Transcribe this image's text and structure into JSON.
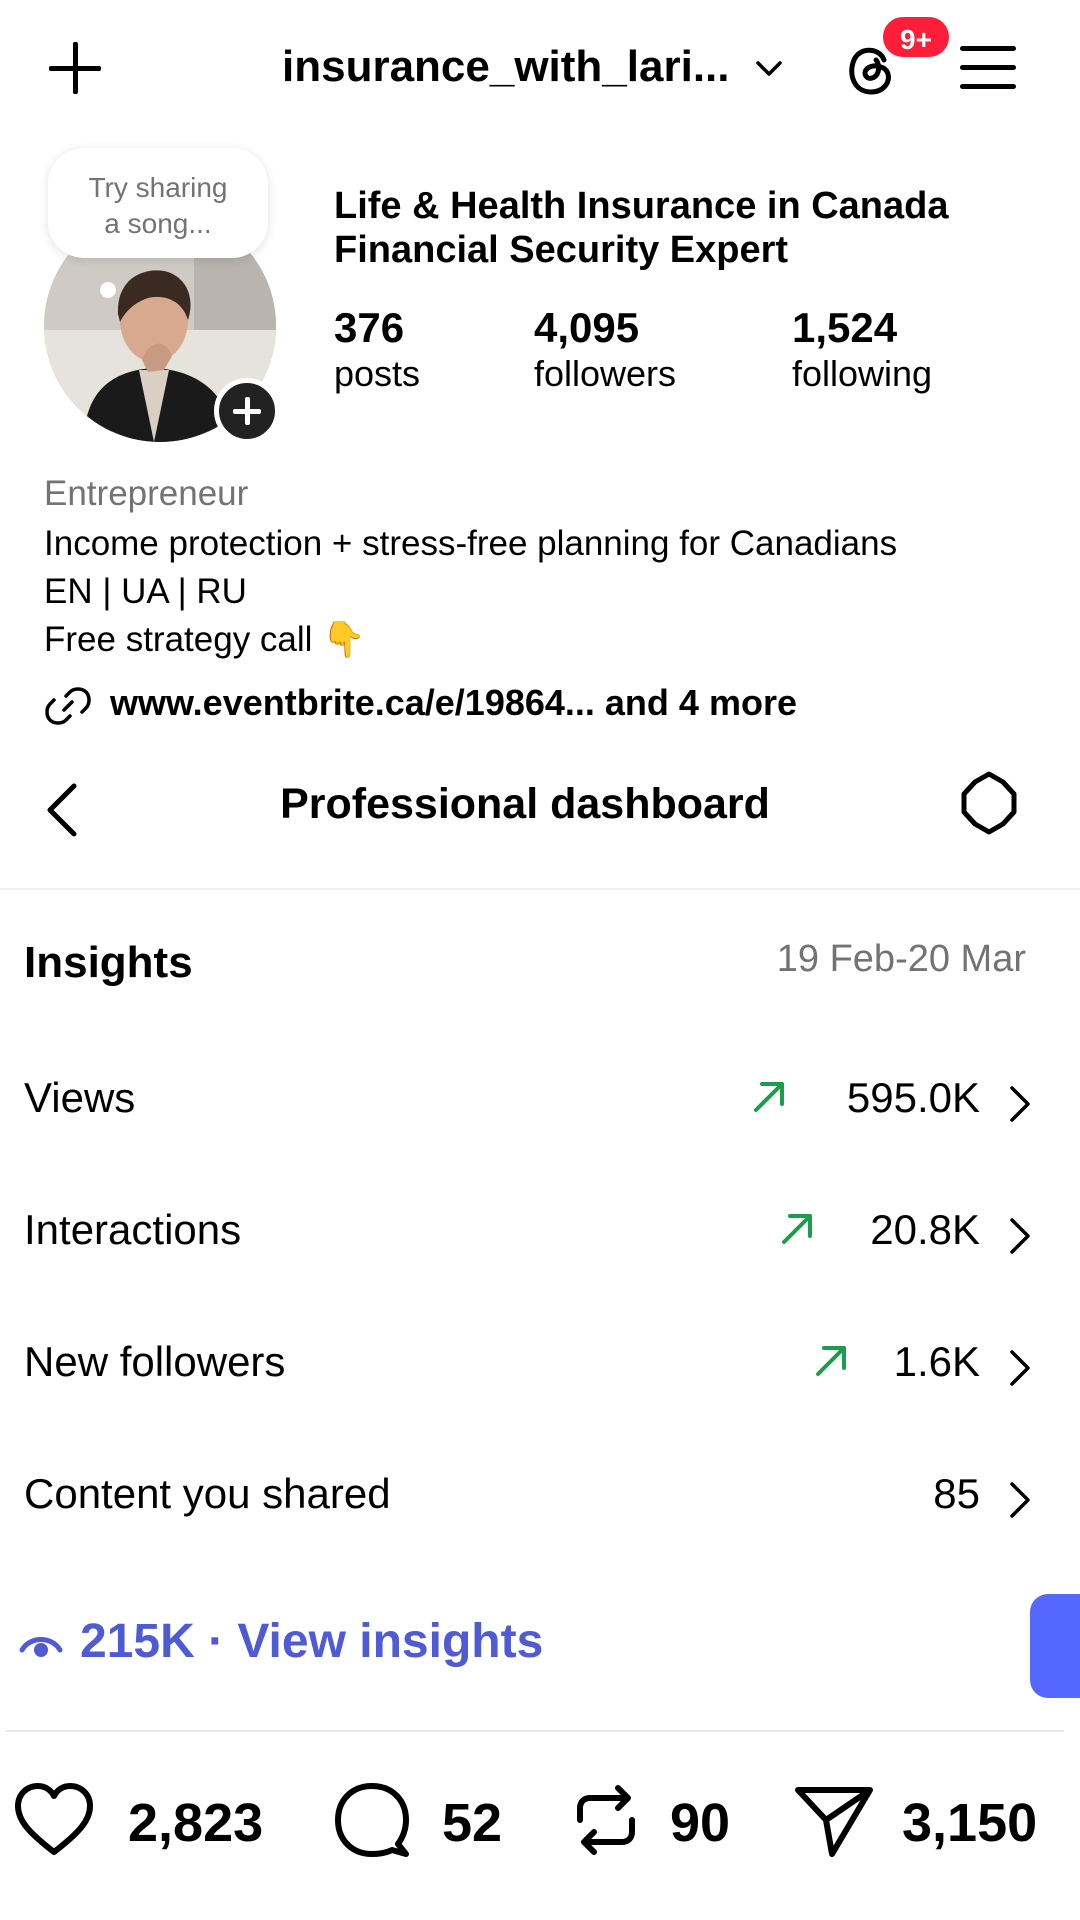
{
  "header": {
    "username": "insurance_with_lari...",
    "notification_count": "9+"
  },
  "profile": {
    "note_prompt": "Try sharing a song...",
    "name_line1": "Life & Health Insurance in Canada",
    "name_line2": "Financial Security Expert",
    "stats": [
      {
        "value": "376",
        "label": "posts"
      },
      {
        "value": "4,095",
        "label": "followers"
      },
      {
        "value": "1,524",
        "label": "following"
      }
    ],
    "category": "Entrepreneur",
    "bio_lines": [
      "Income protection + stress-free planning for Canadians",
      "EN | UA | RU",
      "Free strategy call 👇"
    ],
    "link": "www.eventbrite.ca/e/19864...  and 4 more"
  },
  "dashboard": {
    "title": "Professional dashboard",
    "insights_label": "Insights",
    "date_range": "19 Feb-20 Mar",
    "rows": [
      {
        "label": "Views",
        "value": "595.0K",
        "trend": "up"
      },
      {
        "label": "Interactions",
        "value": "20.8K",
        "trend": "up"
      },
      {
        "label": "New followers",
        "value": "1.6K",
        "trend": "up"
      },
      {
        "label": "Content you shared",
        "value": "85",
        "trend": "none"
      }
    ],
    "view_insights": "215K · View insights"
  },
  "engagement": {
    "likes": "2,823",
    "comments": "52",
    "reposts": "90",
    "shares": "3,150"
  },
  "colors": {
    "accent": "#4f5bd5",
    "trend_up": "#1a9e4b",
    "badge": "#ff1e3a",
    "muted": "#737373"
  }
}
